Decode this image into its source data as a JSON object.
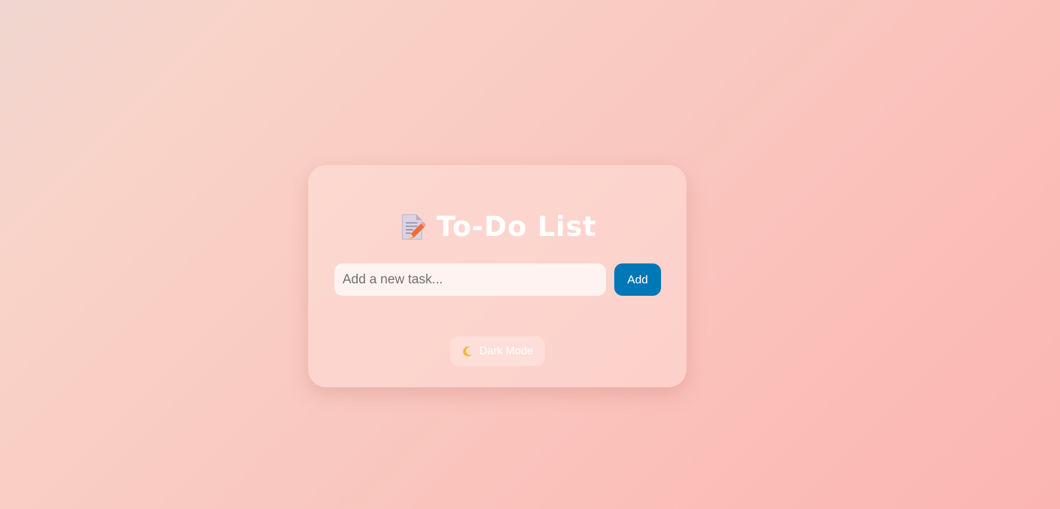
{
  "app": {
    "title": "To-Do List",
    "title_icon": "memo-icon"
  },
  "task_form": {
    "input_value": "",
    "input_placeholder": "Add a new task...",
    "add_label": "Add"
  },
  "theme_toggle": {
    "label": "Dark Mode",
    "icon": "crescent-moon-icon"
  },
  "colors": {
    "accent": "#0077b6",
    "text_on_card": "#ffffff"
  }
}
